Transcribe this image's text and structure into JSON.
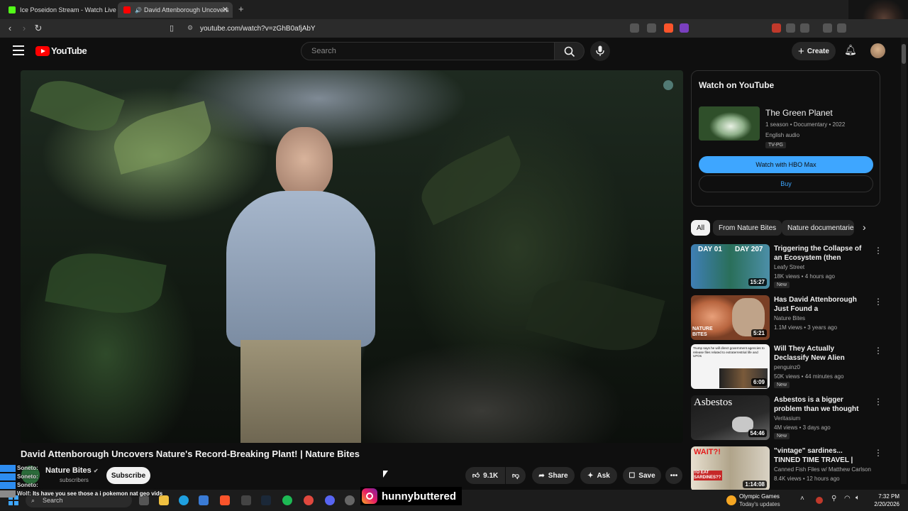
{
  "browser": {
    "tabs": [
      {
        "label": "Ice Poseidon Stream - Watch Live on",
        "active": false
      },
      {
        "label": "David Attenborough Uncovers",
        "active": true
      }
    ],
    "url": "youtube.com/watch?v=zGhB0afjAbY"
  },
  "youtube": {
    "logo_text": "YouTube",
    "search_placeholder": "Search",
    "create_label": "Create"
  },
  "video": {
    "title": "David Attenborough Uncovers Nature's Record-Breaking Plant! | Nature Bites",
    "channel": "Nature Bites",
    "subscribers": "subscribers",
    "subscribe_label": "Subscribe",
    "likes": "9.1K",
    "share_label": "Share",
    "ask_label": "Ask",
    "save_label": "Save"
  },
  "hbo": {
    "heading": "Watch on YouTube",
    "show_title": "The Green Planet",
    "meta": "1 season • Documentary • 2022",
    "audio": "English audio",
    "rating": "TV-PG",
    "watch_label": "Watch with HBO Max",
    "buy_label": "Buy"
  },
  "chips": [
    "All",
    "From Nature Bites",
    "Nature documentaries"
  ],
  "recommendations": [
    {
      "title": "Triggering the Collapse of an Ecosystem (then rebuilding it)",
      "channel": "Leafy Street",
      "meta": "18K views • 4 hours ago",
      "badge": "New",
      "duration": "15:27",
      "thumb_text_a": "DAY 01",
      "thumb_text_b": "DAY 207"
    },
    {
      "title": "Has David Attenborough Just Found a HALLUCIGENIC Plant...",
      "channel": "Nature Bites",
      "meta": "1.1M views • 3 years ago",
      "badge": "",
      "duration": "5:21",
      "thumb_text_a": "NATURE BITES",
      "thumb_text_b": ""
    },
    {
      "title": "Will They Actually Declassify New Alien Information",
      "channel": "penguinz0",
      "meta": "50K views • 44 minutes ago",
      "badge": "New",
      "duration": "6:09",
      "thumb_text_a": "Trump says he will direct government agencies to release files related to extraterrestrial life and UFOs",
      "thumb_text_b": ""
    },
    {
      "title": "Asbestos is a bigger problem than we thought",
      "channel": "Veritasium",
      "meta": "4M views • 3 days ago",
      "badge": "New",
      "duration": "54:46",
      "thumb_text_a": "Asbestos",
      "thumb_text_b": ""
    },
    {
      "title": "\"vintage\" sardines... TINNED TIME TRAVEL | Canned Fish ...",
      "channel": "Canned Fish Files w/ Matthew Carlson",
      "meta": "8.4K views • 12 hours ago",
      "badge": "",
      "duration": "1:14:08",
      "thumb_text_a": "WAIT?!",
      "thumb_text_b": "TO EAT SARDINES??"
    }
  ],
  "overlay": {
    "chat": [
      {
        "user": "Soneto:",
        "text": ""
      },
      {
        "user": "Soneto:",
        "text": ""
      },
      {
        "user": "Soneto:",
        "text": ""
      },
      {
        "user": "Wolf:",
        "text": "Its have you see those a i pokemon nat geo vids"
      }
    ],
    "instagram_handle": "hunnybuttered"
  },
  "taskbar": {
    "search_label": "Search",
    "weather_title": "Olympic Games",
    "weather_sub": "Today's updates",
    "time": "7:32 PM",
    "date": "2/20/2026"
  },
  "colors": {
    "accent_blue": "#3ea6ff",
    "youtube_red": "#ff0000",
    "chip_active": "#f1f1f1"
  }
}
